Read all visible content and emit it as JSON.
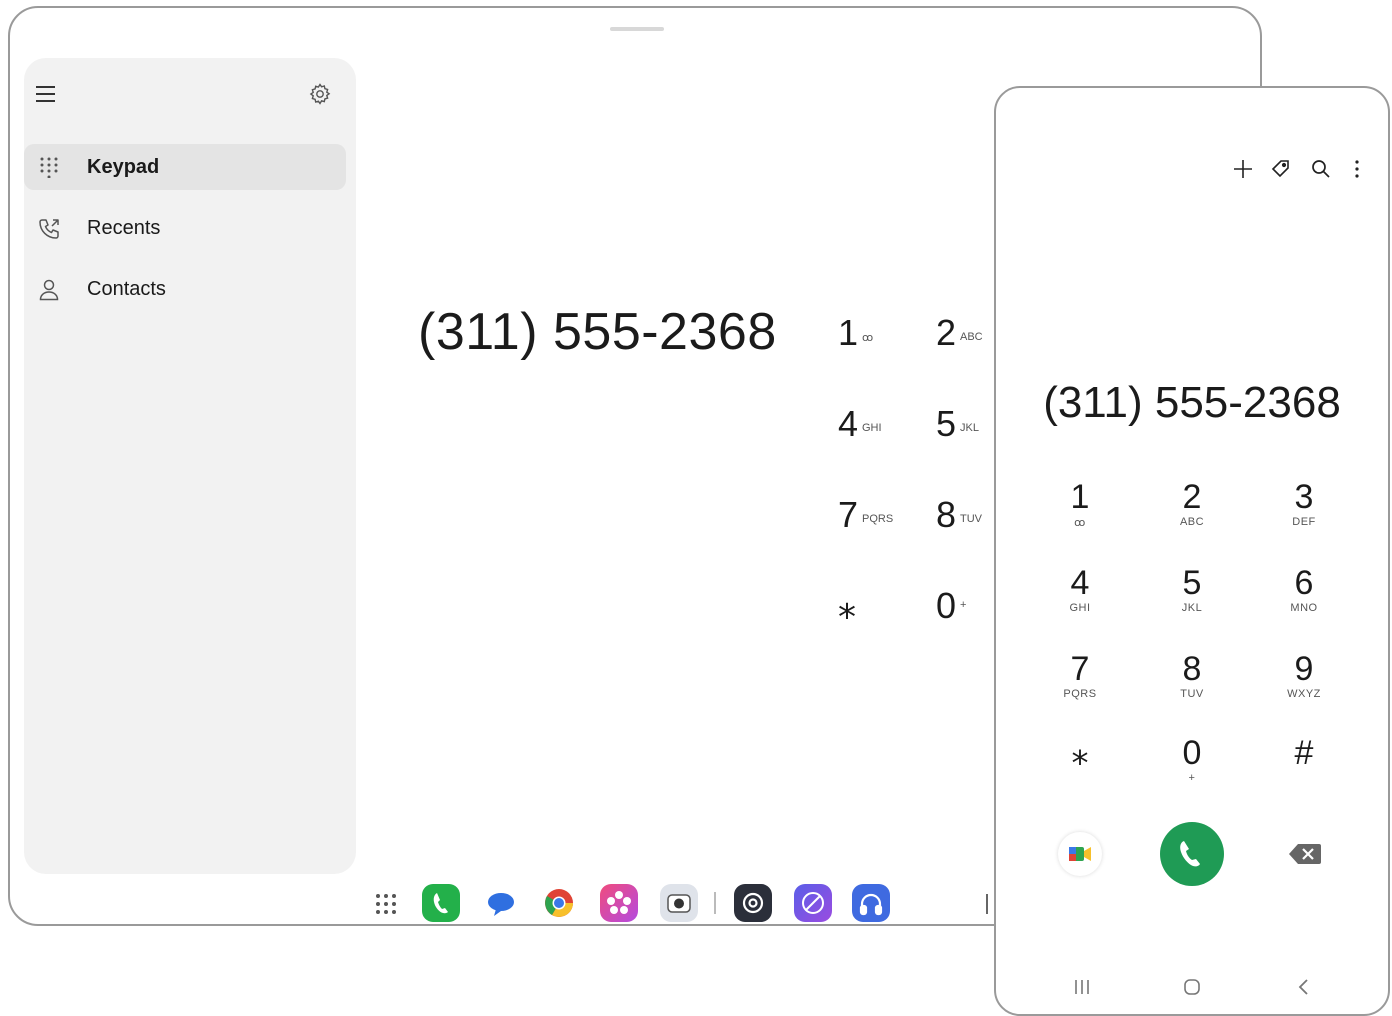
{
  "tablet": {
    "sidebar": {
      "items": [
        {
          "label": "Keypad",
          "icon": "dialpad-icon",
          "active": true
        },
        {
          "label": "Recents",
          "icon": "recent-calls-icon",
          "active": false
        },
        {
          "label": "Contacts",
          "icon": "contact-person-icon",
          "active": false
        }
      ]
    },
    "number": "(311) 555-2368",
    "keys": [
      {
        "digit": "1",
        "sub": "ꝏ"
      },
      {
        "digit": "2",
        "sub": "ABC"
      },
      {
        "digit": "4",
        "sub": "GHI"
      },
      {
        "digit": "5",
        "sub": "JKL"
      },
      {
        "digit": "7",
        "sub": "PQRS"
      },
      {
        "digit": "8",
        "sub": "TUV"
      },
      {
        "digit": "⁎",
        "sub": ""
      },
      {
        "digit": "0",
        "sub": "+"
      }
    ],
    "dock": [
      "apps-grid-icon",
      "phone-app-icon",
      "messages-app-icon",
      "chrome-app-icon",
      "gallery-app-icon",
      "camera-app-icon",
      "settings-app-icon",
      "internet-app-icon",
      "music-app-icon"
    ]
  },
  "phone": {
    "number": "(311) 555-2368",
    "keys": [
      {
        "digit": "1",
        "sub": "ꝏ"
      },
      {
        "digit": "2",
        "sub": "ABC"
      },
      {
        "digit": "3",
        "sub": "DEF"
      },
      {
        "digit": "4",
        "sub": "GHI"
      },
      {
        "digit": "5",
        "sub": "JKL"
      },
      {
        "digit": "6",
        "sub": "MNO"
      },
      {
        "digit": "7",
        "sub": "PQRS"
      },
      {
        "digit": "8",
        "sub": "TUV"
      },
      {
        "digit": "9",
        "sub": "WXYZ"
      },
      {
        "digit": "⁎",
        "sub": ""
      },
      {
        "digit": "0",
        "sub": "+"
      },
      {
        "digit": "#",
        "sub": ""
      }
    ]
  },
  "colors": {
    "call_green": "#1f9b55",
    "sidebar_bg": "#f2f2f2",
    "active_item_bg": "#e4e4e4"
  }
}
